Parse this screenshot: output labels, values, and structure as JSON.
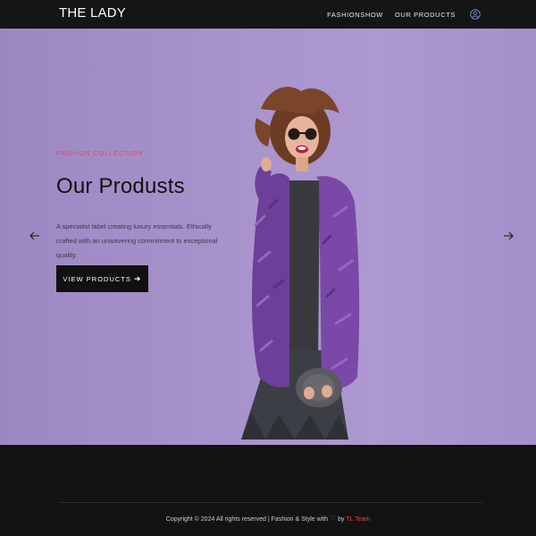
{
  "header": {
    "brand": "THE LADY",
    "nav": [
      {
        "label": "FASHIONSHOW"
      },
      {
        "label": "OUR PRODUCTS"
      }
    ],
    "user_icon": "user-icon"
  },
  "hero": {
    "eyebrow": "FASHION COLLECTION",
    "title": "Our Produsts",
    "description": "A specialist label creating luxury essentials. Ethically crafted with an unwavering commitment to exceptional quality.",
    "cta_label": "VIEW PRODUCTS",
    "cta_icon": "arrow-right-icon",
    "prev_icon": "arrow-left-icon",
    "next_icon": "arrow-right-icon",
    "background_color": "#a993cc",
    "accent_color": "#e84a5f"
  },
  "footer": {
    "copyright_prefix": "Copyright © 2024 All rights reserved | Fashion & Style with",
    "heart_icon": "♡",
    "by_text": " by ",
    "team": "TL Team"
  }
}
